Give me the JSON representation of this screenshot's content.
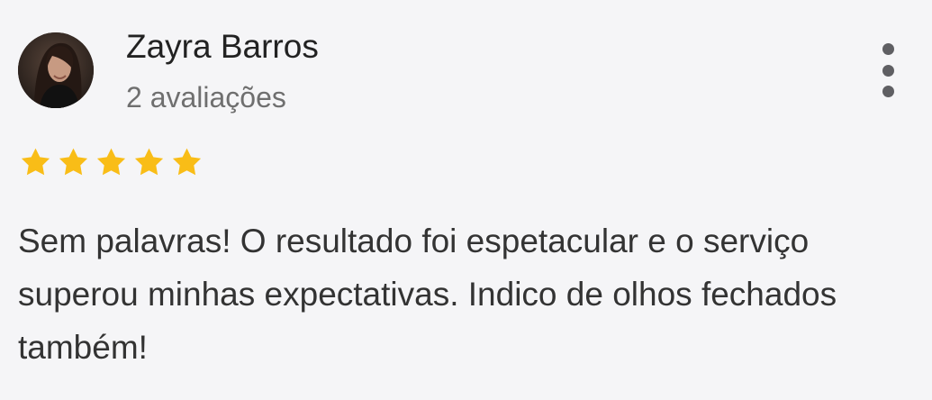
{
  "review": {
    "reviewer_name": "Zayra Barros",
    "review_count": "2 avaliações",
    "rating": 5,
    "rating_max": 5,
    "star_color": "#f9bd17",
    "text": "Sem palavras! O resultado foi espetacular e o serviço superou minhas expectativas. Indico de olhos fechados também!",
    "avatar_icon": "user-photo",
    "menu_icon": "more-vertical-icon"
  }
}
